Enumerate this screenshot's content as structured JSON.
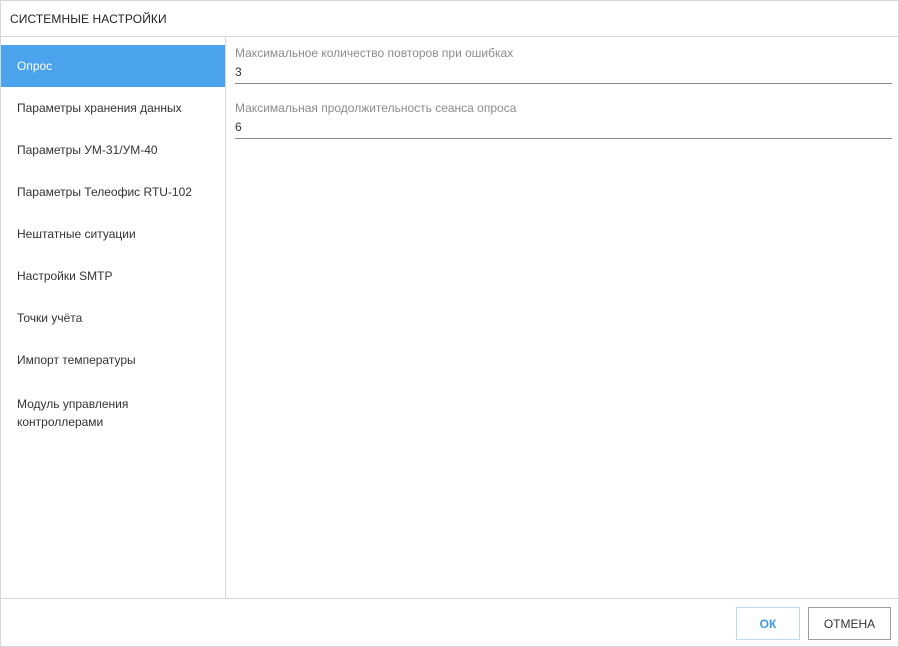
{
  "dialog": {
    "title": "СИСТЕМНЫЕ НАСТРОЙКИ"
  },
  "sidebar": {
    "items": [
      {
        "label": "Опрос",
        "active": true
      },
      {
        "label": "Параметры хранения данных"
      },
      {
        "label": "Параметры УМ-31/УМ-40"
      },
      {
        "label": "Параметры Телеофис RTU-102"
      },
      {
        "label": "Нештатные ситуации"
      },
      {
        "label": "Настройки SMTP"
      },
      {
        "label": "Точки учёта"
      },
      {
        "label": "Импорт температуры"
      },
      {
        "label": "Модуль управления контроллерами"
      }
    ]
  },
  "form": {
    "fields": [
      {
        "label": "Максимальное количество повторов при ошибках",
        "value": "3"
      },
      {
        "label": "Максимальная продолжительность сеанса опроса",
        "value": "6"
      }
    ]
  },
  "footer": {
    "ok_label": "ОК",
    "cancel_label": "ОТМЕНА"
  },
  "colors": {
    "accent": "#4aa3ec",
    "ok_text": "#3f9be6",
    "border": "#d6d6d6"
  }
}
